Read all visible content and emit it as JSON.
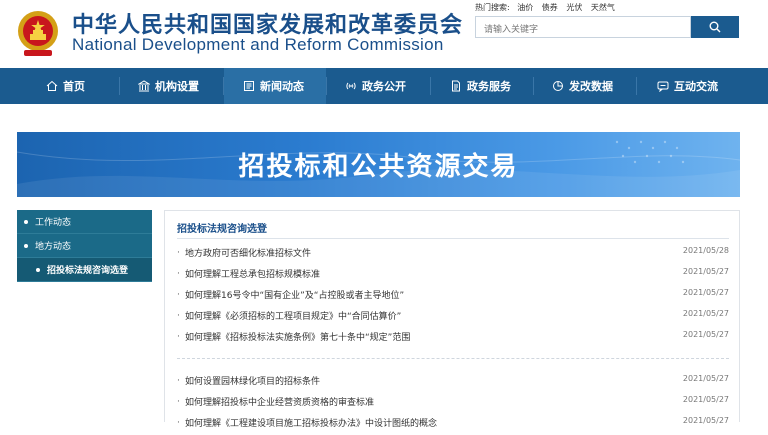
{
  "header": {
    "title_cn": "中华人民共和国国家发展和改革委员会",
    "title_en": "National Development and Reform Commission",
    "hot_label": "热门搜索:",
    "hot_terms": [
      "油价",
      "债券",
      "光伏",
      "天然气"
    ],
    "search_placeholder": "请输入关键字"
  },
  "nav": {
    "items": [
      {
        "label": "首页",
        "icon": "home-icon"
      },
      {
        "label": "机构设置",
        "icon": "building-icon"
      },
      {
        "label": "新闻动态",
        "icon": "news-icon"
      },
      {
        "label": "政务公开",
        "icon": "broadcast-icon"
      },
      {
        "label": "政务服务",
        "icon": "document-icon"
      },
      {
        "label": "发改数据",
        "icon": "pie-chart-icon"
      },
      {
        "label": "互动交流",
        "icon": "chat-icon"
      }
    ]
  },
  "banner": {
    "title": "招投标和公共资源交易"
  },
  "sidebar": {
    "items": [
      "工作动态",
      "地方动态"
    ],
    "active": "招投标法规咨询选登"
  },
  "content": {
    "section_title": "招投标法规咨询选登",
    "group1": [
      {
        "title": "地方政府可否细化标准招标文件",
        "date": "2021/05/28"
      },
      {
        "title": "如何理解工程总承包招标规模标准",
        "date": "2021/05/27"
      },
      {
        "title": "如何理解16号令中“国有企业”及“占控股或者主导地位”",
        "date": "2021/05/27"
      },
      {
        "title": "如何理解《必须招标的工程项目规定》中“合同估算价”",
        "date": "2021/05/27"
      },
      {
        "title": "如何理解《招标投标法实施条例》第七十条中“规定”范围",
        "date": "2021/05/27"
      }
    ],
    "group2": [
      {
        "title": "如何设置园林绿化项目的招标条件",
        "date": "2021/05/27"
      },
      {
        "title": "如何理解招投标中企业经营资质资格的审查标准",
        "date": "2021/05/27"
      },
      {
        "title": "如何理解《工程建设项目施工招标投标办法》中设计图纸的概念",
        "date": "2021/05/27"
      }
    ]
  },
  "colors": {
    "brand": "#1b5b8f",
    "sidebar": "#1b6a88",
    "title_text": "#1a4f8a"
  }
}
